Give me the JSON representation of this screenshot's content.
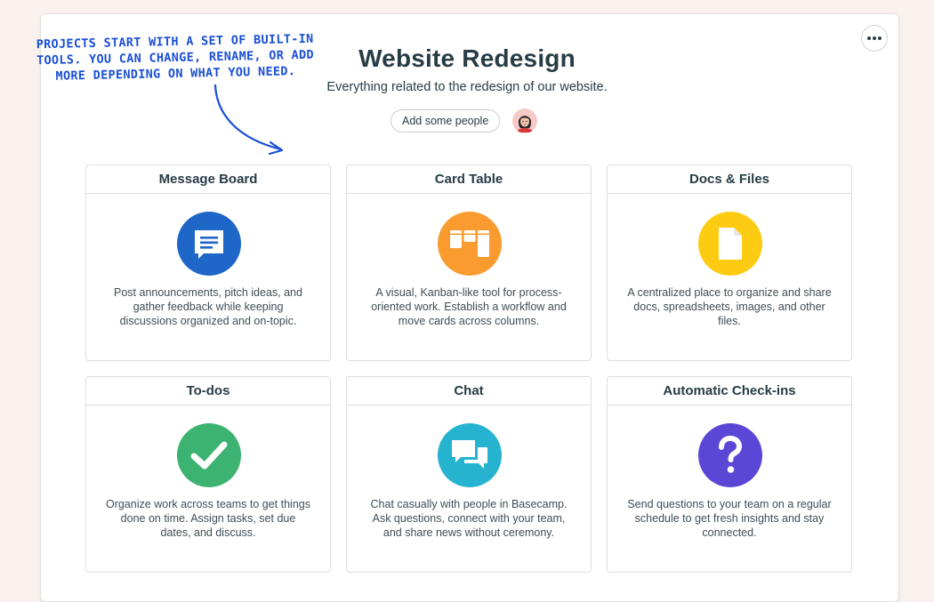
{
  "project": {
    "title": "Website Redesign",
    "subtitle": "Everything related to the redesign of our website.",
    "add_people_label": "Add some people"
  },
  "annotation": {
    "lines": [
      "PROJECTS START WITH A SET OF BUILT-IN",
      "TOOLS. YOU CAN CHANGE, RENAME, OR ADD",
      "MORE DEPENDING ON WHAT YOU NEED."
    ],
    "color": "#1a4fd6"
  },
  "tools": [
    {
      "name": "Message Board",
      "icon": "message-board-icon",
      "color": "#1e66c8",
      "description": "Post announcements, pitch ideas, and gather feedback while keeping discussions organized and on-topic."
    },
    {
      "name": "Card Table",
      "icon": "card-table-icon",
      "color": "#f99b2f",
      "description": "A visual, Kanban-like tool for process-oriented work. Establish a workflow and move cards across columns."
    },
    {
      "name": "Docs & Files",
      "icon": "document-icon",
      "color": "#fccb12",
      "description": "A centralized place to organize and share docs, spreadsheets, images, and other files."
    },
    {
      "name": "To-dos",
      "icon": "checkmark-icon",
      "color": "#3cb371",
      "description": "Organize work across teams to get things done on time. Assign tasks, set due dates, and discuss."
    },
    {
      "name": "Chat",
      "icon": "chat-bubbles-icon",
      "color": "#25b3cf",
      "description": "Chat casually with people in Basecamp. Ask questions, connect with your team, and share news without ceremony."
    },
    {
      "name": "Automatic Check-ins",
      "icon": "question-mark-icon",
      "color": "#5b47d6",
      "description": "Send questions to your team on a regular schedule to get fresh insights and stay connected."
    }
  ]
}
